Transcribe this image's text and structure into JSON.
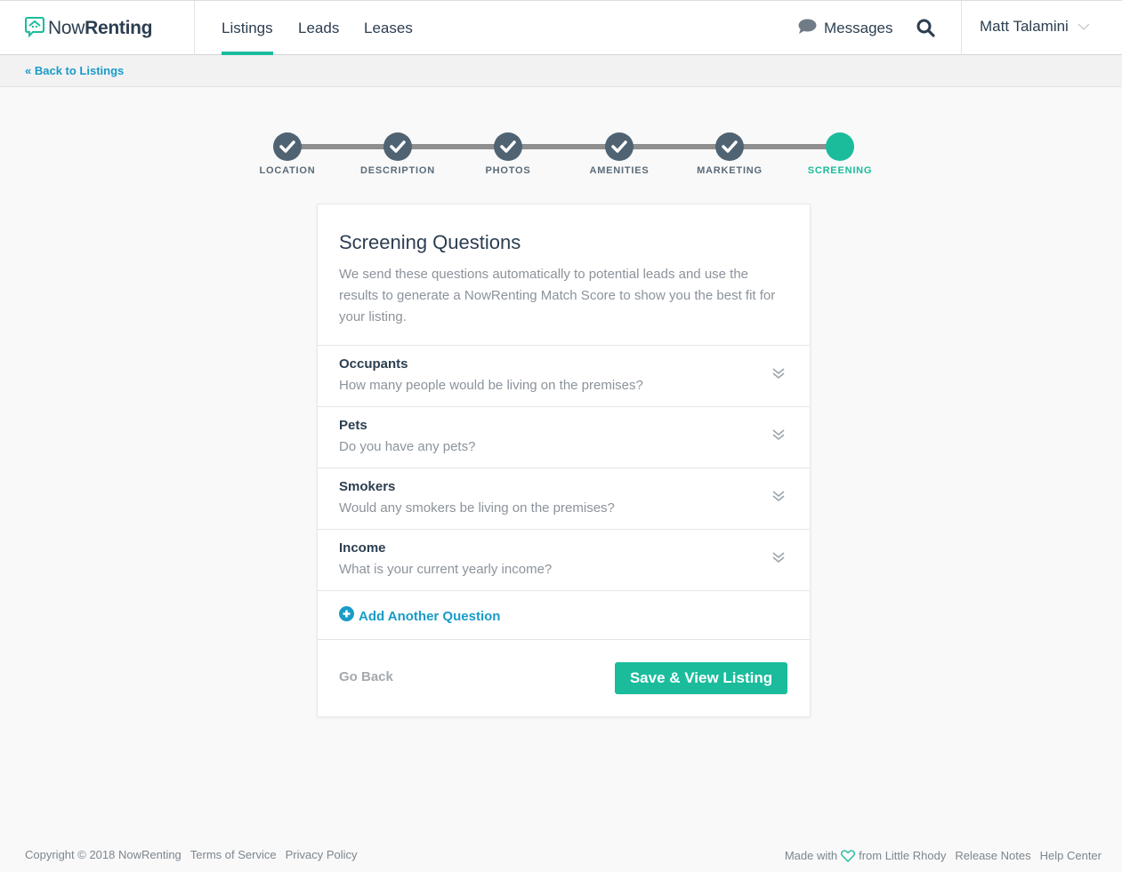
{
  "brand": {
    "name_light": "Now",
    "name_bold": "Renting",
    "accent_color": "#1abc9c",
    "link_color": "#1a9bc8"
  },
  "nav": {
    "tabs": [
      {
        "label": "Listings",
        "active": true
      },
      {
        "label": "Leads",
        "active": false
      },
      {
        "label": "Leases",
        "active": false
      }
    ],
    "messages_label": "Messages",
    "user_name": "Matt Talamini"
  },
  "subnav": {
    "back_link": "« Back to Listings"
  },
  "stepper": {
    "steps": [
      {
        "label": "LOCATION",
        "status": "complete"
      },
      {
        "label": "DESCRIPTION",
        "status": "complete"
      },
      {
        "label": "PHOTOS",
        "status": "complete"
      },
      {
        "label": "AMENITIES",
        "status": "complete"
      },
      {
        "label": "MARKETING",
        "status": "complete"
      },
      {
        "label": "SCREENING",
        "status": "current"
      }
    ]
  },
  "card": {
    "title": "Screening Questions",
    "description": "We send these questions automatically to potential leads and use the results to generate a NowRenting Match Score to show you the best fit for your listing.",
    "questions": [
      {
        "title": "Occupants",
        "text": "How many people would be living on the premises?"
      },
      {
        "title": "Pets",
        "text": "Do you have any pets?"
      },
      {
        "title": "Smokers",
        "text": "Would any smokers be living on the premises?"
      },
      {
        "title": "Income",
        "text": "What is your current yearly income?"
      }
    ],
    "add_question_label": "Add Another Question",
    "go_back_label": "Go Back",
    "save_label": "Save & View Listing"
  },
  "footer": {
    "copyright": "Copyright © 2018 NowRenting",
    "terms": "Terms of Service",
    "privacy": "Privacy Policy",
    "made_with": "Made with",
    "made_from": "from Little Rhody",
    "release_notes": "Release Notes",
    "help_center": "Help Center"
  }
}
